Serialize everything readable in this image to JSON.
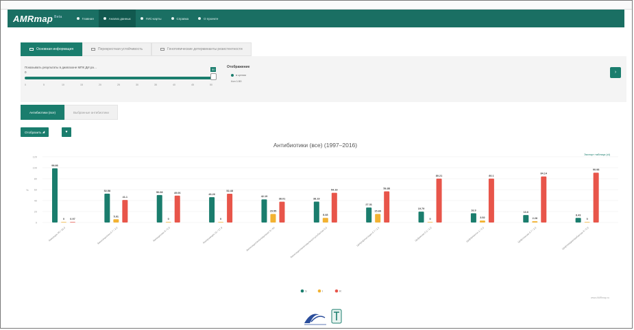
{
  "nav": {
    "brand": "AMRmap",
    "brand_sup": "Beta",
    "items": [
      {
        "label": "Главная",
        "active": false
      },
      {
        "label": "Анализ данных",
        "active": true
      },
      {
        "label": "ГИС-карты",
        "active": false
      },
      {
        "label": "Справка",
        "active": false
      },
      {
        "label": "О проекте",
        "active": false
      }
    ]
  },
  "tabs_main": [
    {
      "label": "Основная информация",
      "active": true
    },
    {
      "label": "Перекрестная устойчивость",
      "active": false
    },
    {
      "label": "Генотипические детерминанты резистентности",
      "active": false
    }
  ],
  "filter": {
    "slider_label": "Показывать результаты в диапазоне МПК ДИ ра…",
    "slider_value": "0",
    "slider_max_label": "50",
    "tick_labels": [
      "0",
      "5",
      "10",
      "15",
      "20",
      "25",
      "30",
      "35",
      "40",
      "45",
      "50"
    ],
    "display_title": "Отображение",
    "radio_options": [
      {
        "label": "в целом",
        "selected": true
      },
      {
        "label": "I/оп 1:50",
        "selected": false
      }
    ],
    "go_button": "›"
  },
  "tabs_sub": [
    {
      "label": "Антибиотики (все)",
      "active": true
    },
    {
      "label": "Выбранные антибиотики",
      "active": false
    }
  ],
  "buttons": {
    "show": "Отобразить",
    "more": "▾"
  },
  "chart_data": {
    "type": "bar",
    "title": "Антибиотики (все) (1997–2016)",
    "link": "Экспорт  таблица (xl)",
    "ylim": [
      0,
      120
    ],
    "yticks": [
      "0",
      "20",
      "40",
      "60",
      "80",
      "100",
      "120"
    ],
    "ylabel": "%",
    "categories": [
      "Амикацин 30 / 16.0",
      "Амоксициллин 0.7 / 2.0",
      "Ампициллин 8 / 0.9",
      "Азитромицин 11 / 17.9",
      "Амоксициллин/клавуланат 8 / 64",
      "Амоксициллин/клавуланат/сульбактам 0.0",
      "Ципрофлоксацин 0.7 / 1.5",
      "Цефиксим 0.1 / 1.0",
      "Цефтриаксон 1 / 2.0",
      "Цефотаксим 0.7 / 2.0",
      "Цефтазидим/авибактам 8 / 0.9"
    ],
    "series": [
      {
        "name": "S",
        "color": "#1a7d6d",
        "values": [
          98.86,
          52.58,
          50.08,
          46.26,
          42.19,
          38.19,
          27.31,
          19.79,
          16.9,
          13.6,
          8.43
        ]
      },
      {
        "name": "I",
        "color": "#f2b232",
        "values": [
          0,
          5.91,
          0,
          0,
          15.55,
          8.48,
          15.69,
          0,
          3.52,
          2.28,
          0
        ]
      },
      {
        "name": "R",
        "color": "#e8554a",
        "values": [
          0.97,
          41.1,
          49.06,
          52.48,
          38.01,
          54.19,
          56.88,
          80.21,
          80.1,
          84.14,
          90.98
        ]
      }
    ],
    "legend": "bottom"
  },
  "credit": "www.AMRmap.ru"
}
